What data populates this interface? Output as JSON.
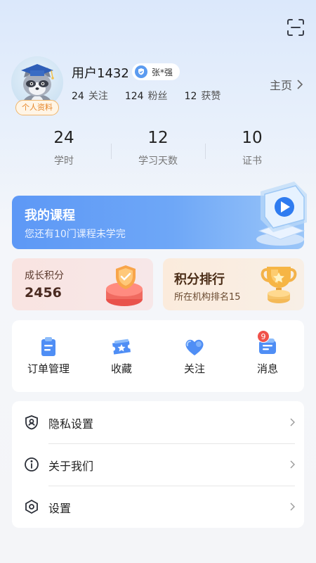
{
  "header": {
    "scan_icon": "scan-icon"
  },
  "profile": {
    "username": "用户1432",
    "verified_name": "张*强",
    "profile_tag": "个人资料",
    "social": [
      {
        "num": "24",
        "label": "关注"
      },
      {
        "num": "124",
        "label": "粉丝"
      },
      {
        "num": "12",
        "label": "获赞"
      }
    ],
    "home_link": "主页"
  },
  "stats": [
    {
      "value": "24",
      "label": "学时"
    },
    {
      "value": "12",
      "label": "学习天数"
    },
    {
      "value": "10",
      "label": "证书"
    }
  ],
  "course_card": {
    "title": "我的课程",
    "subtitle": "您还有10门课程未学完"
  },
  "points_card": {
    "label": "成长积分",
    "value": "2456"
  },
  "rank_card": {
    "title": "积分排行",
    "subtitle": "所在机构排名15"
  },
  "quick_actions": [
    {
      "label": "订单管理",
      "icon": "clipboard-icon"
    },
    {
      "label": "收藏",
      "icon": "ticket-star-icon"
    },
    {
      "label": "关注",
      "icon": "heart-icon"
    },
    {
      "label": "消息",
      "icon": "message-icon",
      "badge": "9"
    }
  ],
  "menu": [
    {
      "label": "隐私设置",
      "icon": "privacy-shield-icon"
    },
    {
      "label": "关于我们",
      "icon": "info-icon"
    },
    {
      "label": "设置",
      "icon": "settings-hex-icon"
    }
  ],
  "colors": {
    "accent": "#5d98f6",
    "badge": "#f0514a",
    "tag_orange": "#e6862a"
  }
}
